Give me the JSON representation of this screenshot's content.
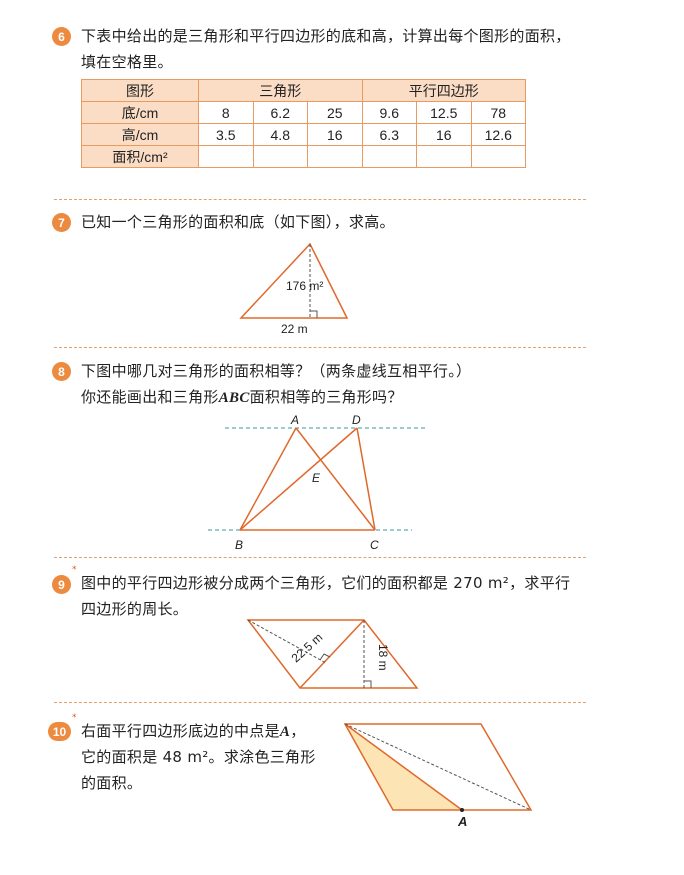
{
  "q6": {
    "number": "6",
    "text_line1": "下表中给出的是三角形和平行四边形的底和高，计算出每个图形的面积，",
    "text_line2": "填在空格里。",
    "table": {
      "header": [
        "图形",
        "三角形",
        "平行四边形"
      ],
      "row_labels": [
        "底/cm",
        "高/cm",
        "面积/cm²"
      ],
      "base": [
        "8",
        "6.2",
        "25",
        "9.6",
        "12.5",
        "78"
      ],
      "height": [
        "3.5",
        "4.8",
        "16",
        "6.3",
        "16",
        "12.6"
      ]
    }
  },
  "q7": {
    "number": "7",
    "text": "已知一个三角形的面积和底（如下图），求高。",
    "area_label": "176 m²",
    "base_label": "22 m"
  },
  "q8": {
    "number": "8",
    "text_line1": "下图中哪几对三角形的面积相等？（两条虚线互相平行。）",
    "text_line2_pre": "你还能画出和三角形",
    "text_line2_abc": "ABC",
    "text_line2_post": "面积相等的三角形吗？",
    "labels": {
      "A": "A",
      "D": "D",
      "E": "E",
      "B": "B",
      "C": "C"
    }
  },
  "q9": {
    "number": "9",
    "star": "*",
    "text_line1": "图中的平行四边形被分成两个三角形，它们的面积都是 270 m²，求平行",
    "text_line2": "四边形的周长。",
    "side_label": "22.5 m",
    "height_label": "18 m"
  },
  "q10": {
    "number": "10",
    "star": "*",
    "text_line1_pre": "右面平行四边形底边的中点是",
    "text_line1_a": "A",
    "text_line1_post": "，",
    "text_line2": "它的面积是 48 m²。求涂色三角形",
    "text_line3": "的面积。",
    "point_label": "A"
  },
  "colors": {
    "accent": "#ec8a3f",
    "line": "#e0682a",
    "header_fill": "#fbdcc4",
    "shade": "#fde4b4"
  }
}
